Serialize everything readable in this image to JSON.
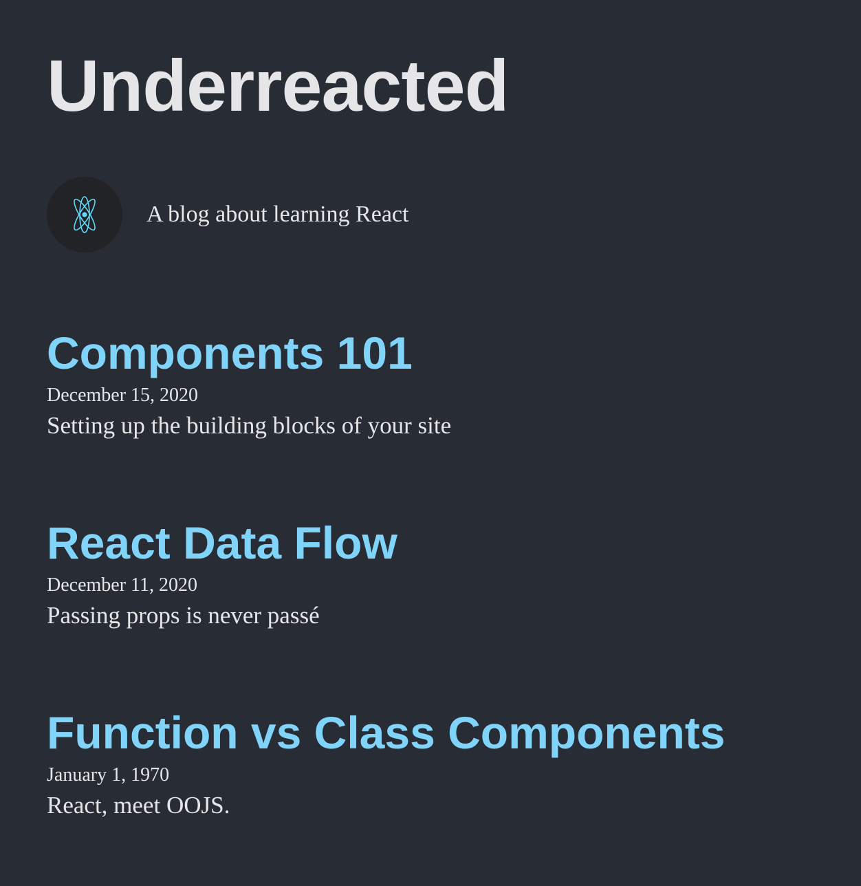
{
  "site": {
    "title": "Underreacted",
    "bio": "A blog about learning React",
    "accent_color": "#81d4f9",
    "background_color": "#282c35"
  },
  "avatar": {
    "icon": "react-logo-icon"
  },
  "posts": [
    {
      "title": "Components 101",
      "date": "December 15, 2020",
      "excerpt": "Setting up the building blocks of your site"
    },
    {
      "title": "React Data Flow",
      "date": "December 11, 2020",
      "excerpt": "Passing props is never passé"
    },
    {
      "title": "Function vs Class Components",
      "date": "January 1, 1970",
      "excerpt": "React, meet OOJS."
    }
  ]
}
